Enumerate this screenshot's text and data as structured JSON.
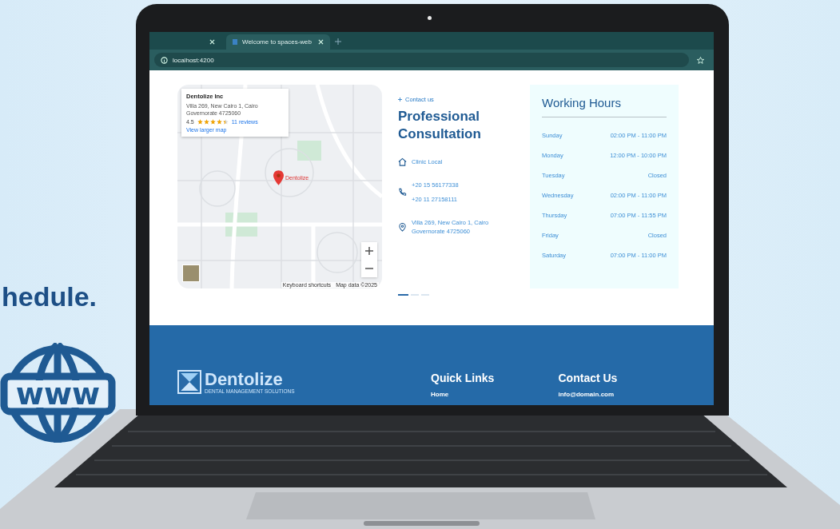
{
  "backdrop_heading": "hedule.",
  "globe_label": "www",
  "browser": {
    "tabs": [
      {
        "selected": false
      },
      {
        "title": "Welcome to spaces-web",
        "selected": true
      }
    ],
    "address": "localhost:4200"
  },
  "map": {
    "place_name": "Dentolize Inc",
    "address": "Villa 269, New Cairo 1, Cairo Governorate 4725060",
    "rating": "4.5",
    "stars": 4.5,
    "reviews_link": "11 reviews",
    "larger_map_link": "View larger map",
    "marker_label": "Dentolize",
    "attribution": [
      "Keyboard shortcuts",
      "Map data ©2025"
    ]
  },
  "contact": {
    "eyebrow": "Contact us",
    "title": "Professional Consultation",
    "items": [
      {
        "kind": "home",
        "lines": [
          "Clinic Local"
        ]
      },
      {
        "kind": "phone",
        "lines": [
          "+20 15 56177338",
          "+20 11 27158111"
        ]
      },
      {
        "kind": "location",
        "lines": [
          "Villa 269, New Cairo 1, Cairo Governorate 4725060"
        ]
      }
    ],
    "carousel_dots": [
      {
        "selected": true
      },
      {
        "selected": false
      },
      {
        "selected": false
      }
    ]
  },
  "working_hours": {
    "title": "Working Hours",
    "rows": [
      {
        "day": "Sunday",
        "hours": "02:00 PM - 11:00 PM"
      },
      {
        "day": "Monday",
        "hours": "12:00 PM - 10:00 PM"
      },
      {
        "day": "Tuesday",
        "hours": "Closed"
      },
      {
        "day": "Wednesday",
        "hours": "02:00 PM - 11:00 PM"
      },
      {
        "day": "Thursday",
        "hours": "07:00 PM - 11:55 PM"
      },
      {
        "day": "Friday",
        "hours": "Closed"
      },
      {
        "day": "Saturday",
        "hours": "07:00 PM - 11:00 PM"
      }
    ]
  },
  "footer": {
    "brand": "Dentolize",
    "tagline": "DENTAL MANAGEMENT SOLUTIONS",
    "columns": [
      {
        "title": "Quick Links",
        "links": [
          "Home"
        ]
      },
      {
        "title": "Contact Us",
        "links": [
          "info@domain.com"
        ]
      }
    ]
  }
}
